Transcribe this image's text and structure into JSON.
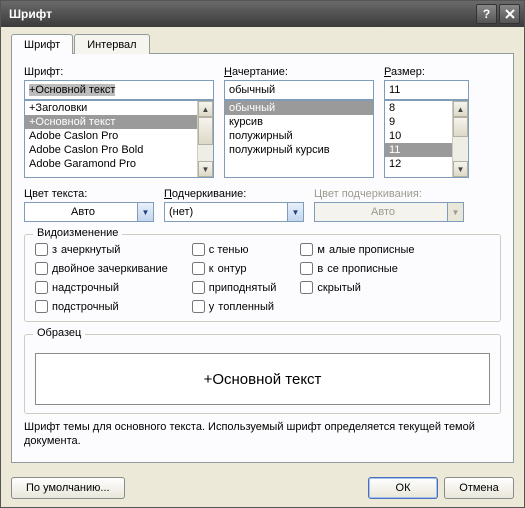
{
  "window": {
    "title": "Шрифт"
  },
  "tabs": {
    "tab_font": "Шрифт",
    "tab_interval": "Интервал"
  },
  "font_section": {
    "label": "Шрифт:",
    "value": "+Основной текст",
    "items": [
      "+Заголовки",
      "+Основной текст",
      "Adobe Caslon Pro",
      "Adobe Caslon Pro Bold",
      "Adobe Garamond Pro"
    ],
    "selected_index": 1
  },
  "style_section": {
    "label": "Начертание:",
    "value": "обычный",
    "items": [
      "обычный",
      "курсив",
      "полужирный",
      "полужирный курсив"
    ],
    "selected_index": 0
  },
  "size_section": {
    "label": "Размер:",
    "value": "11",
    "items": [
      "8",
      "9",
      "10",
      "11",
      "12"
    ],
    "selected_index": 3
  },
  "color_section": {
    "label": "Цвет текста:",
    "value": "Авто"
  },
  "underline_section": {
    "label": "Подчеркивание:",
    "value": "(нет)"
  },
  "underline_color_section": {
    "label": "Цвет подчеркивания:",
    "value": "Авто"
  },
  "effects": {
    "legend": "Видоизменение",
    "col1": [
      "зачеркнутый",
      "двойное зачеркивание",
      "надстрочный",
      "подстрочный"
    ],
    "col2": [
      "с тенью",
      "контур",
      "приподнятый",
      "утопленный"
    ],
    "col3": [
      "малые прописные",
      "все прописные",
      "скрытый"
    ]
  },
  "sample": {
    "legend": "Образец",
    "text": "+Основной текст"
  },
  "description": "Шрифт темы для основного текста. Используемый шрифт определяется текущей темой документа.",
  "buttons": {
    "default": "По умолчанию...",
    "ok": "ОК",
    "cancel": "Отмена"
  }
}
